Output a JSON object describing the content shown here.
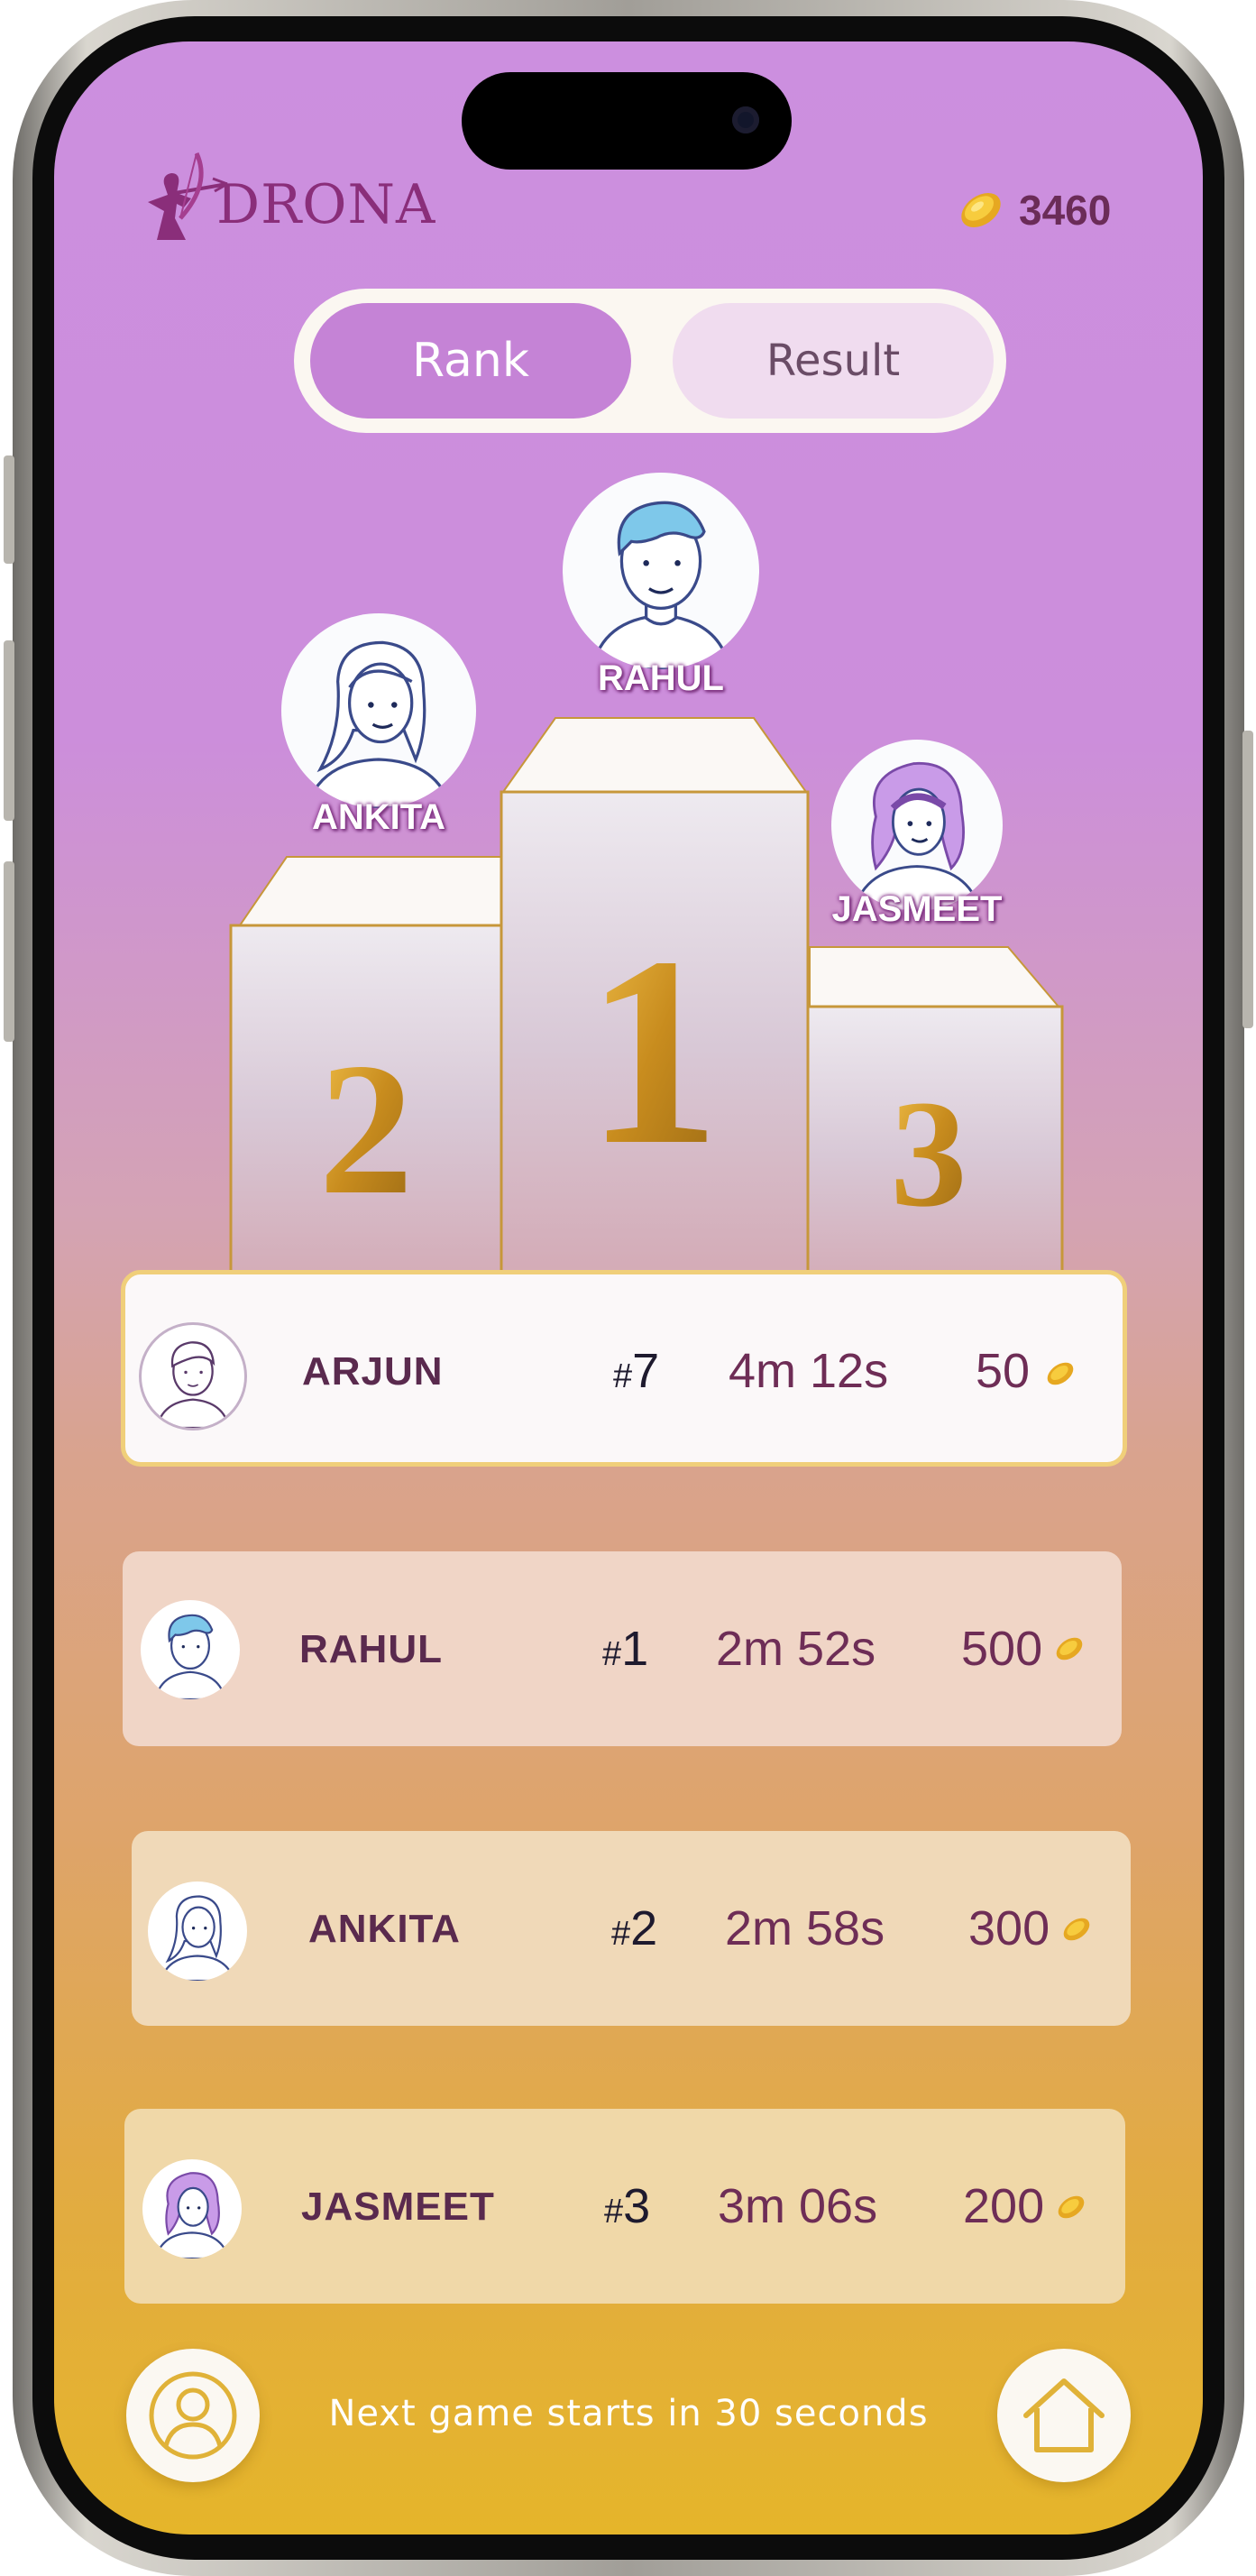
{
  "header": {
    "app_name": "DRONA",
    "coin_balance": "3460",
    "logo_icon": "archer-logo-icon",
    "coin_icon": "gold-coin-icon"
  },
  "tabs": [
    {
      "label": "Rank",
      "active": true
    },
    {
      "label": "Result",
      "active": false
    }
  ],
  "podium": {
    "first": {
      "name": "RAHUL",
      "place": "1"
    },
    "second": {
      "name": "ANKITA",
      "place": "2"
    },
    "third": {
      "name": "JASMEET",
      "place": "3"
    }
  },
  "leaderboard": [
    {
      "name": "ARJUN",
      "rank_prefix": "#",
      "rank": "7",
      "time": "4m 12s",
      "coins": "50",
      "highlighted": true
    },
    {
      "name": "RAHUL",
      "rank_prefix": "#",
      "rank": "1",
      "time": "2m 52s",
      "coins": "500",
      "highlighted": false
    },
    {
      "name": "ANKITA",
      "rank_prefix": "#",
      "rank": "2",
      "time": "2m 58s",
      "coins": "300",
      "highlighted": false
    },
    {
      "name": "JASMEET",
      "rank_prefix": "#",
      "rank": "3",
      "time": "3m 06s",
      "coins": "200",
      "highlighted": false
    }
  ],
  "footer": {
    "message": "Next game starts in 30 seconds",
    "profile_icon": "user-profile-icon",
    "home_icon": "home-icon"
  },
  "colors": {
    "accent": "#c583d6",
    "brand": "#8a2e7a",
    "gold": "#d4a02a",
    "highlight_border": "#f0cf7a"
  }
}
